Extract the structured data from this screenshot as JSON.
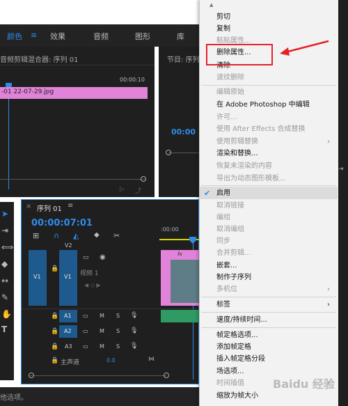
{
  "top_tabs": [
    "颜色",
    "效果",
    "音频",
    "图形",
    "库"
  ],
  "mixer_title": "音频剪辑混合器: 序列 01",
  "mixer_time": "00:00:10",
  "clip_name": "-01 22-07-29.jpg",
  "program_title": "节目: 序列",
  "program_time": "00:00",
  "timeline_tab": "序列 01",
  "timeline_time": "00:00:07:01",
  "ruler_time": ":00:00",
  "tracks": {
    "v2": "V2",
    "v1_source": "V1",
    "v1": "V1",
    "video_label": "视频 1",
    "a1": "A1",
    "a2": "A2",
    "a3": "A3",
    "m": "M",
    "s": "S",
    "master_label": "主声道",
    "master_value": "0.0"
  },
  "clip_fx": "fx",
  "status_text": "他选项。",
  "menu": {
    "items": [
      {
        "label": "剪切",
        "disabled": false
      },
      {
        "label": "复制",
        "disabled": false
      },
      {
        "label": "粘贴属性...",
        "disabled": true
      },
      {
        "label": "删除属性...",
        "disabled": false,
        "highlighted": true
      },
      {
        "label": "清除",
        "disabled": false
      },
      {
        "label": "波纹删除",
        "disabled": true
      },
      {
        "label": "编辑原始",
        "disabled": true
      },
      {
        "label": "在 Adobe Photoshop 中编辑",
        "disabled": false
      },
      {
        "label": "许可...",
        "disabled": true
      },
      {
        "label": "使用 After Effects 合成替换",
        "disabled": true
      },
      {
        "label": "使用剪辑替换",
        "disabled": true,
        "submenu": true
      },
      {
        "label": "渲染和替换...",
        "disabled": false
      },
      {
        "label": "恢复未渲染的内容",
        "disabled": true
      },
      {
        "label": "导出为动态图形模板...",
        "disabled": true
      },
      {
        "label": "启用",
        "disabled": false,
        "checked": true
      },
      {
        "label": "取消链接",
        "disabled": true
      },
      {
        "label": "编组",
        "disabled": true
      },
      {
        "label": "取消编组",
        "disabled": true
      },
      {
        "label": "同步",
        "disabled": true
      },
      {
        "label": "合并剪辑...",
        "disabled": true
      },
      {
        "label": "嵌套...",
        "disabled": false
      },
      {
        "label": "制作子序列",
        "disabled": false
      },
      {
        "label": "多机位",
        "disabled": true,
        "submenu": true
      },
      {
        "label": "标签",
        "disabled": false,
        "submenu": true
      },
      {
        "label": "速度/持续时间...",
        "disabled": false
      },
      {
        "label": "帧定格选项...",
        "disabled": false
      },
      {
        "label": "添加帧定格",
        "disabled": false
      },
      {
        "label": "插入帧定格分段",
        "disabled": false
      },
      {
        "label": "场选项...",
        "disabled": false
      },
      {
        "label": "时间插值",
        "disabled": true,
        "submenu": true
      },
      {
        "label": "缩放为帧大小",
        "disabled": false
      }
    ]
  },
  "watermark": "Baidu 经验",
  "colors": {
    "accent_blue": "#2d8ceb",
    "annotation_red": "#e8202a",
    "clip_pink": "#e183d8",
    "audio_green": "#2f9a63"
  },
  "icons": [
    "selection-tool-icon",
    "track-select-icon",
    "ripple-edit-icon",
    "razor-icon",
    "slip-icon",
    "pen-icon",
    "hand-icon",
    "type-icon",
    "wrench-icon",
    "marker-icon",
    "eye-icon",
    "mic-icon",
    "lock-icon",
    "checkmark-icon"
  ]
}
